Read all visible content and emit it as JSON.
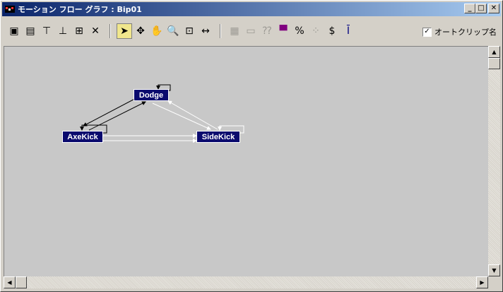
{
  "window": {
    "title": "モーション フロー グラフ : Bip01",
    "controls": {
      "minimize": "_",
      "maximize": "□",
      "close": "✕"
    }
  },
  "toolbar": {
    "left_group": [
      {
        "name": "create-motion-clip-icon",
        "glyph": "▣"
      },
      {
        "name": "create-multiple-clips-icon",
        "glyph": "▤"
      },
      {
        "name": "create-transition-icon",
        "glyph": "⊤"
      },
      {
        "name": "create-transition-from-icon",
        "glyph": "⊥"
      },
      {
        "name": "create-random-transition-icon",
        "glyph": "⊞"
      },
      {
        "name": "delete-icon",
        "glyph": "✕"
      }
    ],
    "nav_group": [
      {
        "name": "select-icon",
        "glyph": "➤",
        "active": true
      },
      {
        "name": "move-icon",
        "glyph": "✥"
      },
      {
        "name": "pan-icon",
        "glyph": "✋"
      },
      {
        "name": "zoom-icon",
        "glyph": "🔍"
      },
      {
        "name": "zoom-region-icon",
        "glyph": "⊡"
      },
      {
        "name": "zoom-extents-icon",
        "glyph": "↔"
      }
    ],
    "right_group": [
      {
        "name": "show-scripts-icon",
        "glyph": "▦",
        "disabled": true
      },
      {
        "name": "show-clip-names-icon",
        "glyph": "▭",
        "disabled": true
      },
      {
        "name": "clip-info-icon",
        "glyph": "⁇",
        "disabled": true
      },
      {
        "name": "set-start-clip-icon",
        "glyph": "▀"
      },
      {
        "name": "percent-icon",
        "glyph": "%"
      },
      {
        "name": "random-icon",
        "glyph": "⁘",
        "disabled": true
      },
      {
        "name": "dollar-icon",
        "glyph": "$"
      },
      {
        "name": "transition-info-icon",
        "glyph": "Ī"
      }
    ],
    "autoclip": {
      "label": "オートクリップ名",
      "checked": true
    }
  },
  "graph": {
    "nodes": [
      {
        "id": "dodge",
        "label": "Dodge"
      },
      {
        "id": "axekick",
        "label": "AxeKick"
      },
      {
        "id": "sidekick",
        "label": "SideKick"
      }
    ]
  },
  "colors": {
    "node_bg": "#0a0a6e",
    "canvas_bg": "#c8c8c8",
    "titlebar_start": "#0a246a",
    "titlebar_end": "#a6caf0"
  }
}
